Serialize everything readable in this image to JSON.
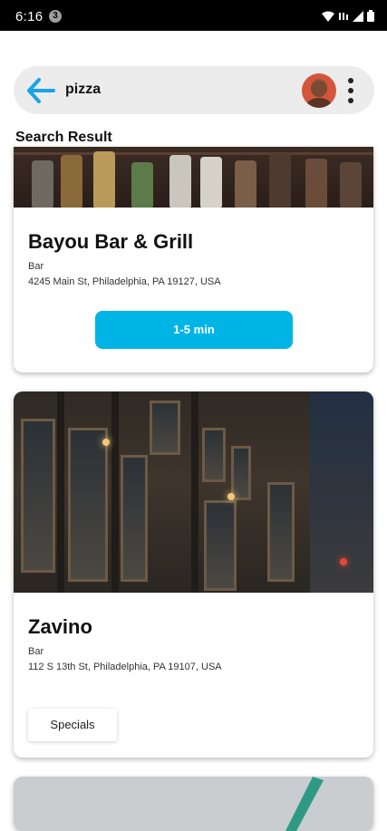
{
  "status_bar": {
    "time": "6:16",
    "notification_count": "3"
  },
  "search": {
    "query": "pizza"
  },
  "section": {
    "title": "Search Result"
  },
  "results": [
    {
      "name": "Bayou Bar & Grill",
      "type": "Bar",
      "address": "4245 Main St, Philadelphia, PA 19127, USA",
      "wait": "1-5 min"
    },
    {
      "name": "Zavino",
      "type": "Bar",
      "address": "112 S 13th St, Philadelphia, PA 19107, USA",
      "action": "Specials"
    }
  ],
  "colors": {
    "accent": "#00b4e6",
    "back_arrow": "#1aa3e8",
    "search_bg": "#ececec"
  },
  "icons": {
    "back": "arrow-left-icon",
    "more": "more-vertical-icon",
    "wifi": "wifi-icon",
    "signal": "signal-icon",
    "battery": "battery-icon"
  }
}
